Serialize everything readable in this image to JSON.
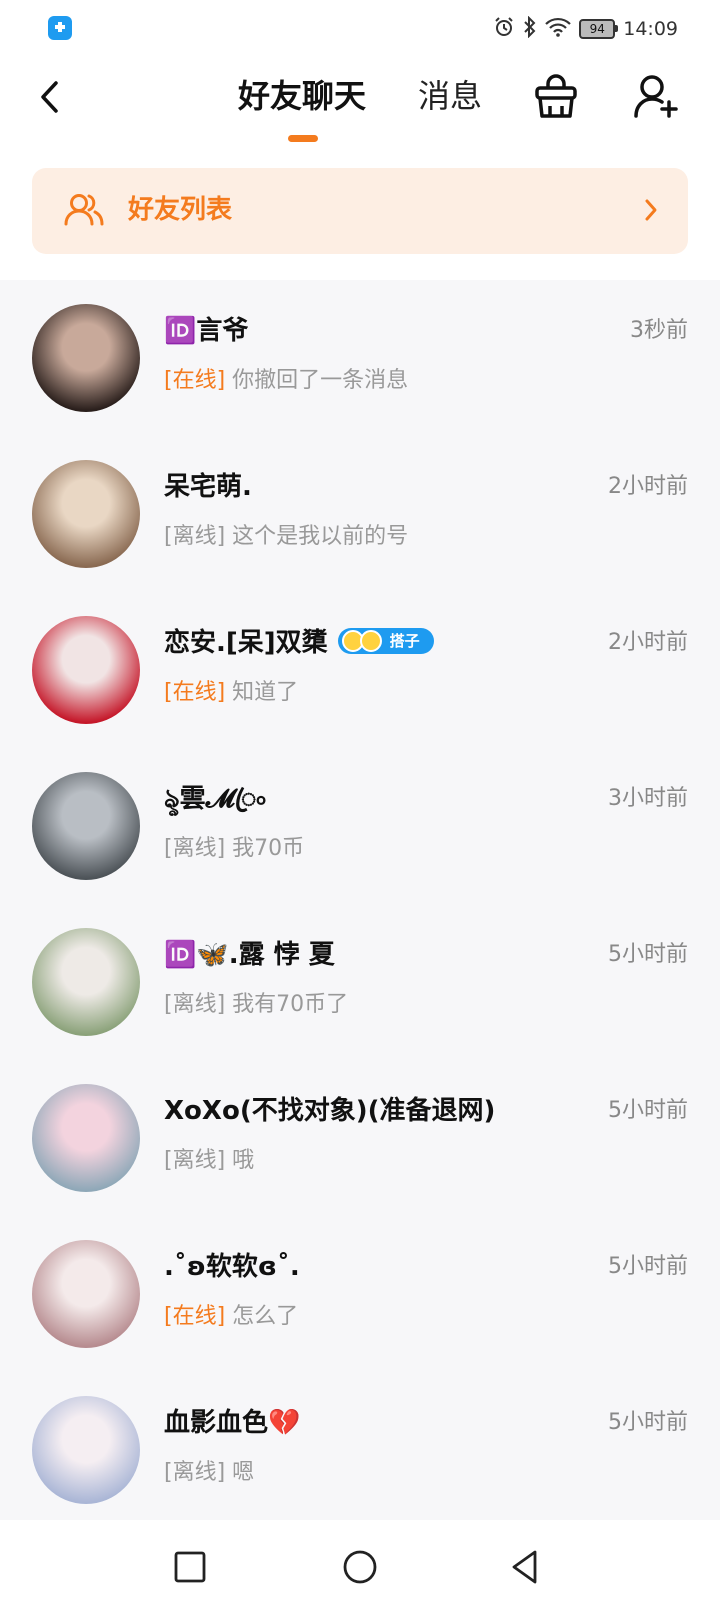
{
  "status_bar": {
    "battery": "94",
    "time": "14:09"
  },
  "header": {
    "tab_active": "好友聊天",
    "tab_inactive": "消息"
  },
  "friends_list": {
    "label": "好友列表"
  },
  "chats": [
    {
      "name": "🆔言爷",
      "time": "3秒前",
      "status": "[在线]",
      "online": true,
      "message": "你撤回了一条消息",
      "avatar_colors": [
        "#2a1f1c",
        "#c8a99a"
      ]
    },
    {
      "name": "呆宅萌.",
      "time": "2小时前",
      "status": "[离线]",
      "online": false,
      "message": "这个是我以前的号",
      "avatar_colors": [
        "#8a6a52",
        "#e9d7c4"
      ]
    },
    {
      "name": "恋安.[呆]双橥",
      "time": "2小时前",
      "status": "[在线]",
      "online": true,
      "message": "知道了",
      "avatar_colors": [
        "#c5182a",
        "#f1e4e4"
      ],
      "tag": "搭子"
    },
    {
      "name": "ৡ雲𝓜ꦿ৹",
      "time": "3小时前",
      "status": "[离线]",
      "online": false,
      "message": "我70币",
      "avatar_colors": [
        "#4d5358",
        "#b9bec4"
      ]
    },
    {
      "name": "🆔🦋.露  悖 夏",
      "time": "5小时前",
      "status": "[离线]",
      "online": false,
      "message": "我有70币了",
      "avatar_colors": [
        "#8ba27a",
        "#eeeae6"
      ]
    },
    {
      "name": "XoXo(不找对象)(准备退网)",
      "time": "5小时前",
      "status": "[离线]",
      "online": false,
      "message": "哦",
      "avatar_colors": [
        "#8fa8b8",
        "#f3d3de"
      ]
    },
    {
      "name": ".˚ʚ软软ɞ˚.",
      "time": "5小时前",
      "status": "[在线]",
      "online": true,
      "message": "怎么了",
      "avatar_colors": [
        "#b78c90",
        "#f4eaea"
      ]
    },
    {
      "name": "血影血色💔",
      "time": "5小时前",
      "status": "[离线]",
      "online": false,
      "message": "嗯",
      "avatar_colors": [
        "#aab6d6",
        "#f5eef2"
      ]
    }
  ],
  "colors": {
    "accent": "#f47b1e",
    "card_bg": "#fdeee3"
  }
}
